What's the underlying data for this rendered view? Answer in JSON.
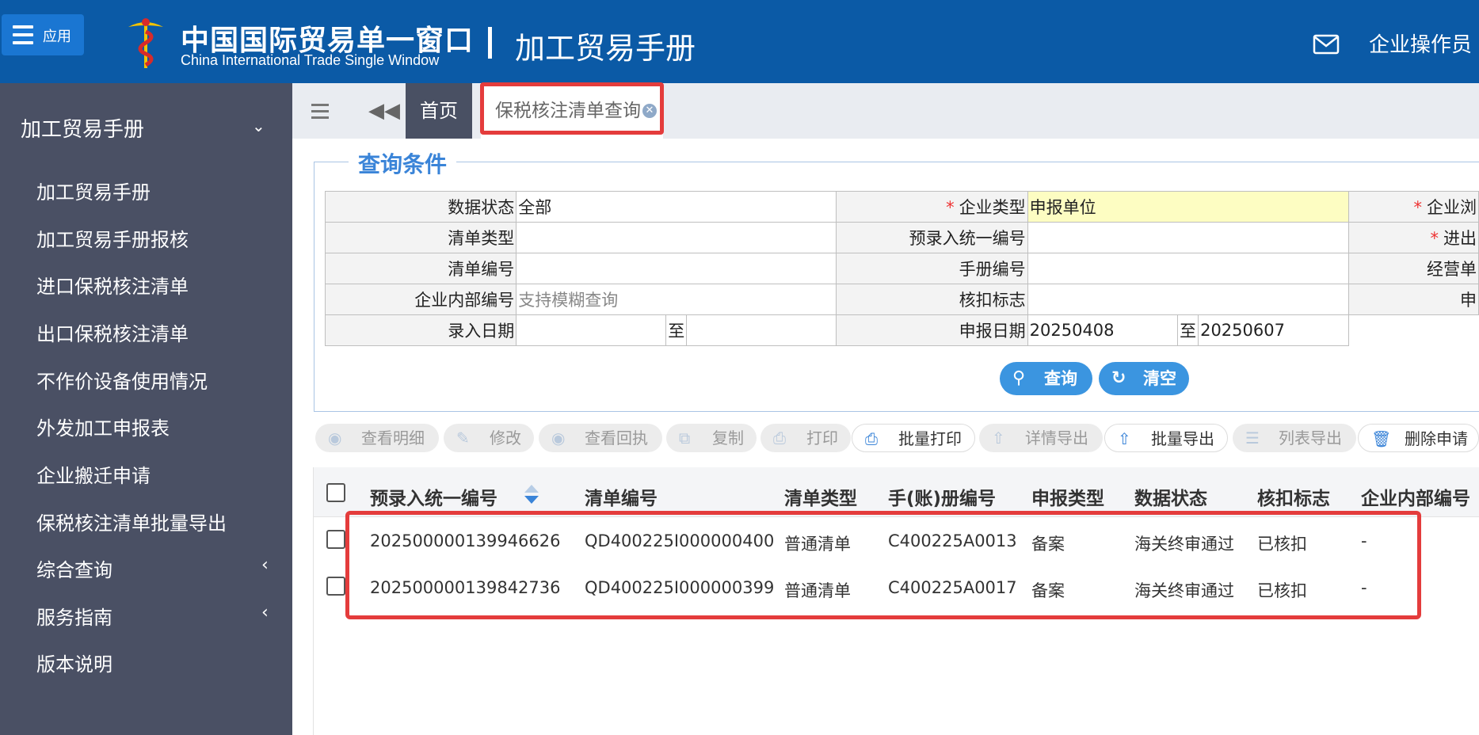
{
  "header": {
    "app_label": "应用",
    "brand_cn": "中国国际贸易单一窗口",
    "brand_en": "China International Trade Single Window",
    "title": "加工贸易手册",
    "user": "企业操作员",
    "icons": {
      "menu": "hamburger-icon",
      "mail": "mail-icon",
      "logo": "customs-emblem"
    }
  },
  "sidebar": {
    "group": "加工贸易手册",
    "items": [
      {
        "label": "加工贸易手册"
      },
      {
        "label": "加工贸易手册报核"
      },
      {
        "label": "进口保税核注清单"
      },
      {
        "label": "出口保税核注清单"
      },
      {
        "label": "不作价设备使用情况"
      },
      {
        "label": "外发加工申报表"
      },
      {
        "label": "企业搬迁申请"
      },
      {
        "label": "保税核注清单批量导出"
      },
      {
        "label": "综合查询"
      },
      {
        "label": "服务指南"
      },
      {
        "label": "版本说明"
      }
    ]
  },
  "tabs": {
    "home": "首页",
    "current": "保税核注清单查询"
  },
  "query": {
    "legend": "查询条件",
    "data_status_label": "数据状态",
    "data_status_value": "全部",
    "enterprise_type_label": "企业类型",
    "enterprise_type_value": "申报单位",
    "col3_row1_label": "企业浏",
    "list_type_label": "清单类型",
    "pre_entry_no_label": "预录入统一编号",
    "col3_row2_label": "进出",
    "list_no_label": "清单编号",
    "manual_no_label": "手册编号",
    "col3_row3_label": "经营单",
    "internal_no_label": "企业内部编号",
    "internal_no_placeholder": "支持模糊查询",
    "deduct_flag_label": "核扣标志",
    "col3_row4_label": "申",
    "entry_date_label": "录入日期",
    "to": "至",
    "declare_date_label": "申报日期",
    "declare_date_from": "20250408",
    "declare_date_to": "20250607",
    "search_btn": "查询",
    "clear_btn": "清空"
  },
  "toolbar": {
    "buttons": [
      {
        "label": "查看明细",
        "enabled": false,
        "icon": "eye-icon"
      },
      {
        "label": "修改",
        "enabled": false,
        "icon": "edit-icon"
      },
      {
        "label": "查看回执",
        "enabled": false,
        "icon": "eye-icon"
      },
      {
        "label": "复制",
        "enabled": false,
        "icon": "copy-icon"
      },
      {
        "label": "打印",
        "enabled": false,
        "icon": "print-icon"
      },
      {
        "label": "批量打印",
        "enabled": true,
        "icon": "print-icon"
      },
      {
        "label": "详情导出",
        "enabled": false,
        "icon": "upload-icon"
      },
      {
        "label": "批量导出",
        "enabled": true,
        "icon": "upload-icon"
      },
      {
        "label": "列表导出",
        "enabled": false,
        "icon": "list-icon"
      },
      {
        "label": "删除申请",
        "enabled": true,
        "icon": "trash-icon"
      }
    ]
  },
  "grid": {
    "columns": [
      "预录入统一编号",
      "清单编号",
      "清单类型",
      "手(账)册编号",
      "申报类型",
      "数据状态",
      "核扣标志",
      "企业内部编号"
    ],
    "rows": [
      [
        "202500000139946626",
        "QD400225I000000400",
        "普通清单",
        "C400225A0013",
        "备案",
        "海关终审通过",
        "已核扣",
        "-"
      ],
      [
        "202500000139842736",
        "QD400225I000000399",
        "普通清单",
        "C400225A0017",
        "备案",
        "海关终审通过",
        "已核扣",
        "-"
      ]
    ]
  },
  "colors": {
    "header_bg": "#0b5aa6",
    "sidebar_bg": "#4a5064",
    "accent": "#3b95e0",
    "highlight": "#e43c3c"
  }
}
